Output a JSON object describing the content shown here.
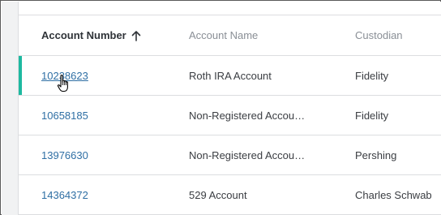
{
  "table": {
    "columns": [
      {
        "label": "Account Number",
        "sorted": "ascending"
      },
      {
        "label": "Account Name"
      },
      {
        "label": "Custodian"
      }
    ],
    "rows": [
      {
        "number": "10238623",
        "name": "Roth IRA Account",
        "custodian": "Fidelity",
        "selected": true
      },
      {
        "number": "10658185",
        "name": "Non-Registered Accou…",
        "custodian": "Fidelity"
      },
      {
        "number": "13976630",
        "name": "Non-Registered Accou…",
        "custodian": "Pershing"
      },
      {
        "number": "14364372",
        "name": "529 Account",
        "custodian": "Charles Schwab"
      }
    ]
  },
  "colors": {
    "link": "#2f6fa4",
    "selected_indicator": "#1db9a0",
    "header_active": "#2f3338",
    "header_muted": "#8a8f96"
  },
  "icons": {
    "sort": "arrow-up-icon",
    "cursor": "hand-pointer-icon"
  }
}
